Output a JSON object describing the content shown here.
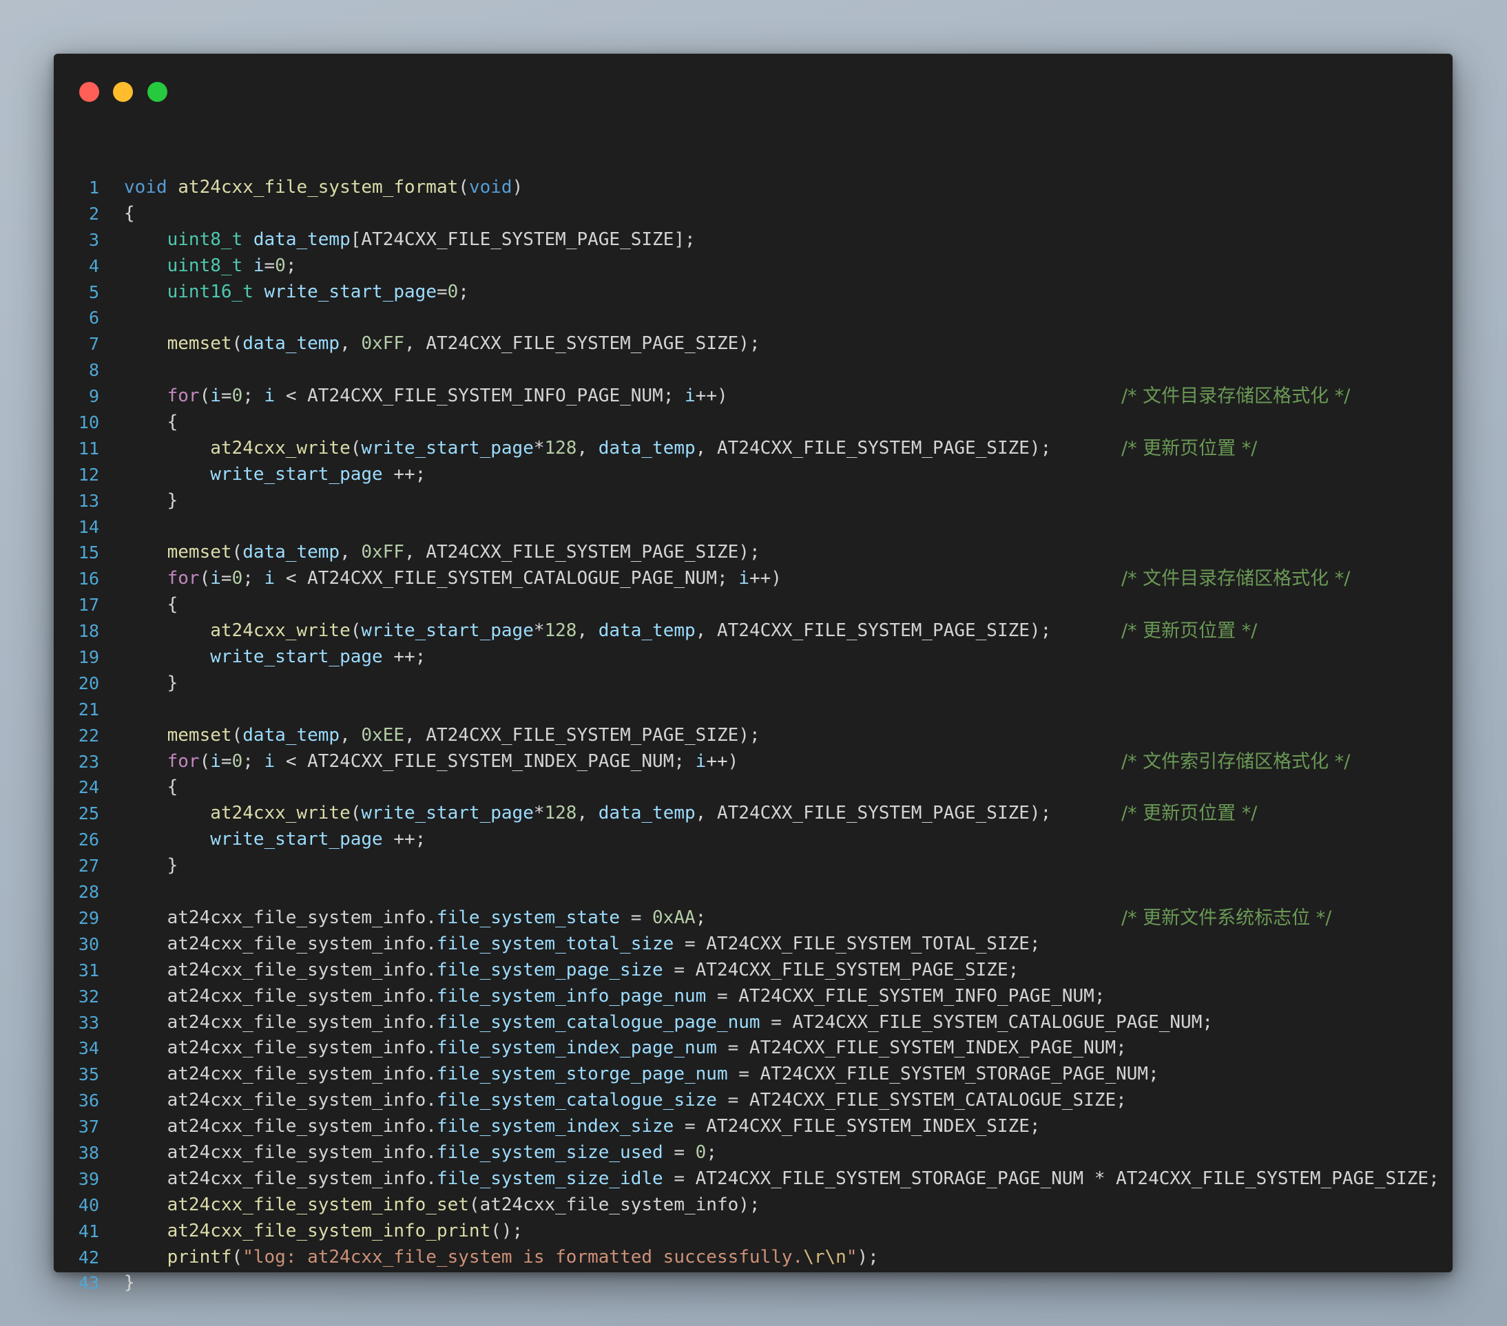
{
  "window": {
    "traffic_lights": [
      {
        "name": "close",
        "color": "#ff5f56"
      },
      {
        "name": "minimize",
        "color": "#ffbd2e"
      },
      {
        "name": "maximize",
        "color": "#27c93f"
      }
    ]
  },
  "editor": {
    "lines": [
      {
        "n": "1",
        "tokens": [
          [
            "void",
            "k"
          ],
          [
            " ",
            ""
          ],
          [
            "at24cxx_file_system_format",
            "f"
          ],
          [
            "(",
            ""
          ],
          [
            "void",
            "k"
          ],
          [
            ")",
            ""
          ]
        ]
      },
      {
        "n": "2",
        "tokens": [
          [
            "{",
            ""
          ]
        ]
      },
      {
        "n": "3",
        "tokens": [
          [
            "    ",
            ""
          ],
          [
            "uint8_t",
            "t"
          ],
          [
            " ",
            ""
          ],
          [
            "data_temp",
            "v"
          ],
          [
            "[AT24CXX_FILE_SYSTEM_PAGE_SIZE];",
            ""
          ]
        ]
      },
      {
        "n": "4",
        "tokens": [
          [
            "    ",
            ""
          ],
          [
            "uint8_t",
            "t"
          ],
          [
            " ",
            ""
          ],
          [
            "i",
            "v"
          ],
          [
            "=",
            ""
          ],
          [
            "0",
            "n"
          ],
          [
            ";",
            ""
          ]
        ]
      },
      {
        "n": "5",
        "tokens": [
          [
            "    ",
            ""
          ],
          [
            "uint16_t",
            "t"
          ],
          [
            " ",
            ""
          ],
          [
            "write_start_page",
            "v"
          ],
          [
            "=",
            ""
          ],
          [
            "0",
            "n"
          ],
          [
            ";",
            ""
          ]
        ]
      },
      {
        "n": "6",
        "tokens": []
      },
      {
        "n": "7",
        "tokens": [
          [
            "    ",
            ""
          ],
          [
            "memset",
            "f"
          ],
          [
            "(",
            ""
          ],
          [
            "data_temp",
            "v"
          ],
          [
            ", ",
            ""
          ],
          [
            "0xFF",
            "n"
          ],
          [
            ", AT24CXX_FILE_SYSTEM_PAGE_SIZE);",
            ""
          ]
        ]
      },
      {
        "n": "8",
        "tokens": []
      },
      {
        "n": "9",
        "tokens": [
          [
            "    ",
            ""
          ],
          [
            "for",
            "p"
          ],
          [
            "(",
            ""
          ],
          [
            "i",
            "v"
          ],
          [
            "=",
            ""
          ],
          [
            "0",
            "n"
          ],
          [
            "; ",
            ""
          ],
          [
            "i",
            "v"
          ],
          [
            " < AT24CXX_FILE_SYSTEM_INFO_PAGE_NUM; ",
            ""
          ],
          [
            "i",
            "v"
          ],
          [
            "++)",
            ""
          ]
        ],
        "comment": "/* 文件目录存储区格式化 */"
      },
      {
        "n": "10",
        "tokens": [
          [
            "    {",
            ""
          ]
        ]
      },
      {
        "n": "11",
        "tokens": [
          [
            "        ",
            ""
          ],
          [
            "at24cxx_write",
            "f"
          ],
          [
            "(",
            ""
          ],
          [
            "write_start_page",
            "v"
          ],
          [
            "*",
            ""
          ],
          [
            "128",
            "n"
          ],
          [
            ", ",
            ""
          ],
          [
            "data_temp",
            "v"
          ],
          [
            ", AT24CXX_FILE_SYSTEM_PAGE_SIZE);",
            ""
          ]
        ],
        "comment": "/* 更新页位置 */"
      },
      {
        "n": "12",
        "tokens": [
          [
            "        ",
            ""
          ],
          [
            "write_start_page",
            "v"
          ],
          [
            " ++;",
            ""
          ]
        ]
      },
      {
        "n": "13",
        "tokens": [
          [
            "    }",
            ""
          ]
        ]
      },
      {
        "n": "14",
        "tokens": []
      },
      {
        "n": "15",
        "tokens": [
          [
            "    ",
            ""
          ],
          [
            "memset",
            "f"
          ],
          [
            "(",
            ""
          ],
          [
            "data_temp",
            "v"
          ],
          [
            ", ",
            ""
          ],
          [
            "0xFF",
            "n"
          ],
          [
            ", AT24CXX_FILE_SYSTEM_PAGE_SIZE);",
            ""
          ]
        ]
      },
      {
        "n": "16",
        "tokens": [
          [
            "    ",
            ""
          ],
          [
            "for",
            "p"
          ],
          [
            "(",
            ""
          ],
          [
            "i",
            "v"
          ],
          [
            "=",
            ""
          ],
          [
            "0",
            "n"
          ],
          [
            "; ",
            ""
          ],
          [
            "i",
            "v"
          ],
          [
            " < AT24CXX_FILE_SYSTEM_CATALOGUE_PAGE_NUM; ",
            ""
          ],
          [
            "i",
            "v"
          ],
          [
            "++)",
            ""
          ]
        ],
        "comment": "/* 文件目录存储区格式化 */"
      },
      {
        "n": "17",
        "tokens": [
          [
            "    {",
            ""
          ]
        ]
      },
      {
        "n": "18",
        "tokens": [
          [
            "        ",
            ""
          ],
          [
            "at24cxx_write",
            "f"
          ],
          [
            "(",
            ""
          ],
          [
            "write_start_page",
            "v"
          ],
          [
            "*",
            ""
          ],
          [
            "128",
            "n"
          ],
          [
            ", ",
            ""
          ],
          [
            "data_temp",
            "v"
          ],
          [
            ", AT24CXX_FILE_SYSTEM_PAGE_SIZE);",
            ""
          ]
        ],
        "comment": "/* 更新页位置 */"
      },
      {
        "n": "19",
        "tokens": [
          [
            "        ",
            ""
          ],
          [
            "write_start_page",
            "v"
          ],
          [
            " ++;",
            ""
          ]
        ]
      },
      {
        "n": "20",
        "tokens": [
          [
            "    }",
            ""
          ]
        ]
      },
      {
        "n": "21",
        "tokens": []
      },
      {
        "n": "22",
        "tokens": [
          [
            "    ",
            ""
          ],
          [
            "memset",
            "f"
          ],
          [
            "(",
            ""
          ],
          [
            "data_temp",
            "v"
          ],
          [
            ", ",
            ""
          ],
          [
            "0xEE",
            "n"
          ],
          [
            ", AT24CXX_FILE_SYSTEM_PAGE_SIZE);",
            ""
          ]
        ]
      },
      {
        "n": "23",
        "tokens": [
          [
            "    ",
            ""
          ],
          [
            "for",
            "p"
          ],
          [
            "(",
            ""
          ],
          [
            "i",
            "v"
          ],
          [
            "=",
            ""
          ],
          [
            "0",
            "n"
          ],
          [
            "; ",
            ""
          ],
          [
            "i",
            "v"
          ],
          [
            " < AT24CXX_FILE_SYSTEM_INDEX_PAGE_NUM; ",
            ""
          ],
          [
            "i",
            "v"
          ],
          [
            "++)",
            ""
          ]
        ],
        "comment": "/* 文件索引存储区格式化 */"
      },
      {
        "n": "24",
        "tokens": [
          [
            "    {",
            ""
          ]
        ]
      },
      {
        "n": "25",
        "tokens": [
          [
            "        ",
            ""
          ],
          [
            "at24cxx_write",
            "f"
          ],
          [
            "(",
            ""
          ],
          [
            "write_start_page",
            "v"
          ],
          [
            "*",
            ""
          ],
          [
            "128",
            "n"
          ],
          [
            ", ",
            ""
          ],
          [
            "data_temp",
            "v"
          ],
          [
            ", AT24CXX_FILE_SYSTEM_PAGE_SIZE);",
            ""
          ]
        ],
        "comment": "/* 更新页位置 */"
      },
      {
        "n": "26",
        "tokens": [
          [
            "        ",
            ""
          ],
          [
            "write_start_page",
            "v"
          ],
          [
            " ++;",
            ""
          ]
        ]
      },
      {
        "n": "27",
        "tokens": [
          [
            "    }",
            ""
          ]
        ]
      },
      {
        "n": "28",
        "tokens": []
      },
      {
        "n": "29",
        "tokens": [
          [
            "    at24cxx_file_system_info.",
            ""
          ],
          [
            "file_system_state",
            "v"
          ],
          [
            " = ",
            ""
          ],
          [
            "0xAA",
            "n"
          ],
          [
            ";",
            ""
          ]
        ],
        "comment": "/* 更新文件系统标志位 */"
      },
      {
        "n": "30",
        "tokens": [
          [
            "    at24cxx_file_system_info.",
            ""
          ],
          [
            "file_system_total_size",
            "v"
          ],
          [
            " = AT24CXX_FILE_SYSTEM_TOTAL_SIZE;",
            ""
          ]
        ]
      },
      {
        "n": "31",
        "tokens": [
          [
            "    at24cxx_file_system_info.",
            ""
          ],
          [
            "file_system_page_size",
            "v"
          ],
          [
            " = AT24CXX_FILE_SYSTEM_PAGE_SIZE;",
            ""
          ]
        ]
      },
      {
        "n": "32",
        "tokens": [
          [
            "    at24cxx_file_system_info.",
            ""
          ],
          [
            "file_system_info_page_num",
            "v"
          ],
          [
            " = AT24CXX_FILE_SYSTEM_INFO_PAGE_NUM;",
            ""
          ]
        ]
      },
      {
        "n": "33",
        "tokens": [
          [
            "    at24cxx_file_system_info.",
            ""
          ],
          [
            "file_system_catalogue_page_num",
            "v"
          ],
          [
            " = AT24CXX_FILE_SYSTEM_CATALOGUE_PAGE_NUM;",
            ""
          ]
        ]
      },
      {
        "n": "34",
        "tokens": [
          [
            "    at24cxx_file_system_info.",
            ""
          ],
          [
            "file_system_index_page_num",
            "v"
          ],
          [
            " = AT24CXX_FILE_SYSTEM_INDEX_PAGE_NUM;",
            ""
          ]
        ]
      },
      {
        "n": "35",
        "tokens": [
          [
            "    at24cxx_file_system_info.",
            ""
          ],
          [
            "file_system_storge_page_num",
            "v"
          ],
          [
            " = AT24CXX_FILE_SYSTEM_STORAGE_PAGE_NUM;",
            ""
          ]
        ]
      },
      {
        "n": "36",
        "tokens": [
          [
            "    at24cxx_file_system_info.",
            ""
          ],
          [
            "file_system_catalogue_size",
            "v"
          ],
          [
            " = AT24CXX_FILE_SYSTEM_CATALOGUE_SIZE;",
            ""
          ]
        ]
      },
      {
        "n": "37",
        "tokens": [
          [
            "    at24cxx_file_system_info.",
            ""
          ],
          [
            "file_system_index_size",
            "v"
          ],
          [
            " = AT24CXX_FILE_SYSTEM_INDEX_SIZE;",
            ""
          ]
        ]
      },
      {
        "n": "38",
        "tokens": [
          [
            "    at24cxx_file_system_info.",
            ""
          ],
          [
            "file_system_size_used",
            "v"
          ],
          [
            " = ",
            ""
          ],
          [
            "0",
            "n"
          ],
          [
            ";",
            ""
          ]
        ]
      },
      {
        "n": "39",
        "tokens": [
          [
            "    at24cxx_file_system_info.",
            ""
          ],
          [
            "file_system_size_idle",
            "v"
          ],
          [
            " = AT24CXX_FILE_SYSTEM_STORAGE_PAGE_NUM * AT24CXX_FILE_SYSTEM_PAGE_SIZE;",
            ""
          ]
        ]
      },
      {
        "n": "40",
        "tokens": [
          [
            "    ",
            ""
          ],
          [
            "at24cxx_file_system_info_set",
            "f"
          ],
          [
            "(at24cxx_file_system_info);",
            ""
          ]
        ]
      },
      {
        "n": "41",
        "tokens": [
          [
            "    ",
            ""
          ],
          [
            "at24cxx_file_system_info_print",
            "f"
          ],
          [
            "();",
            ""
          ]
        ]
      },
      {
        "n": "42",
        "tokens": [
          [
            "    ",
            ""
          ],
          [
            "printf",
            "f"
          ],
          [
            "(",
            ""
          ],
          [
            "\"log: at24cxx_file_system is formatted successfully.",
            "s"
          ],
          [
            "\\r\\n",
            "e"
          ],
          [
            "\"",
            "s"
          ],
          [
            ");",
            ""
          ]
        ]
      },
      {
        "n": "43",
        "tokens": [
          [
            "}",
            ""
          ]
        ]
      }
    ]
  }
}
